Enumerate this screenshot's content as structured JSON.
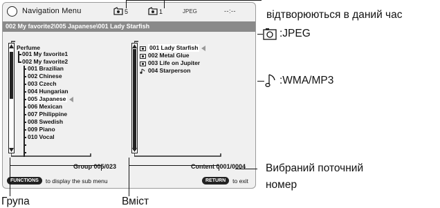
{
  "screen": {
    "menu_title": "Navigation Menu",
    "group_count": "5",
    "content_count": "1",
    "format": "JPEG",
    "clock": "--:--",
    "path": "002 My favorite2\\005 Japanese\\001 Lady Starfish"
  },
  "tree": {
    "root": "Perfume",
    "items": [
      "001 My favorite1",
      "002 My favorite2",
      "001 Brazilian",
      "002 Chinese",
      "003 Czech",
      "004 Hungarian",
      "005 Japanese",
      "006 Mexican",
      "007 Philippine",
      "008 Swedish",
      "009 Piano",
      "010 Vocal"
    ]
  },
  "contents": [
    {
      "label": "001 Lady Starfish",
      "icon": "camera-icon"
    },
    {
      "label": "002 Metal Glue",
      "icon": "camera-icon"
    },
    {
      "label": "003 Life on Jupiter",
      "icon": "camera-icon"
    },
    {
      "label": "004 Starperson",
      "icon": "music-note-icon"
    }
  ],
  "footer": {
    "group_info": "Group 005/023",
    "content_info": "Content 0001/0004",
    "functions_key": "FUNCTIONS",
    "functions_text": "to display the sub menu",
    "return_key": "RETURN",
    "return_text": "to exit"
  },
  "annotations": {
    "playing_now_line2": "відтворюються в даний час",
    "jpeg_label": ":JPEG",
    "wma_label": ":WMA/MP3",
    "current_number_line1": "Вибраний поточний",
    "current_number_line2": "номер",
    "group_label": "Група",
    "content_label": "Вміст"
  }
}
